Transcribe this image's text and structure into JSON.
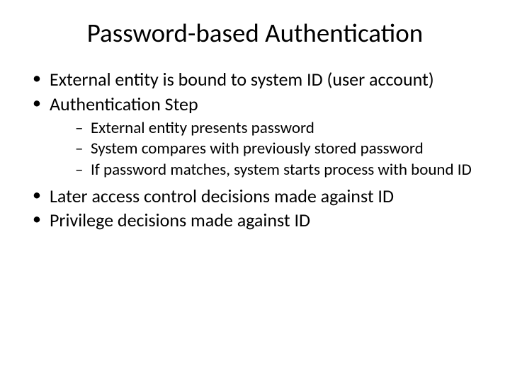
{
  "slide": {
    "title": "Password-based Authentication",
    "bullets": {
      "b1": "External entity is bound to system ID (user account)",
      "b2": "Authentication Step",
      "b2_sub": {
        "s1": "External entity presents password",
        "s2": "System compares with previously stored password",
        "s3": "If password matches, system starts process with bound ID"
      },
      "b3": "Later access control decisions made against ID",
      "b4": "Privilege decisions made against ID"
    }
  }
}
